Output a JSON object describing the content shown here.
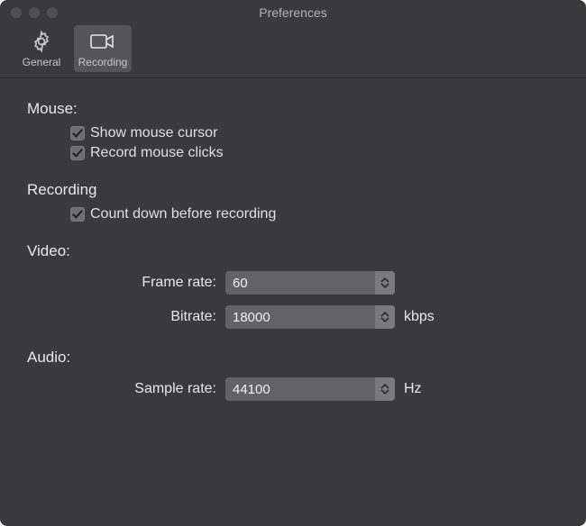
{
  "window": {
    "title": "Preferences"
  },
  "toolbar": {
    "items": [
      {
        "label": "General"
      },
      {
        "label": "Recording"
      }
    ],
    "selectedIndex": 1
  },
  "sections": {
    "mouse": {
      "heading": "Mouse:",
      "options": [
        {
          "label": "Show mouse cursor",
          "checked": true
        },
        {
          "label": "Record mouse clicks",
          "checked": true
        }
      ]
    },
    "recording": {
      "heading": "Recording",
      "options": [
        {
          "label": "Count down before recording",
          "checked": true
        }
      ]
    },
    "video": {
      "heading": "Video:",
      "fields": {
        "frameRate": {
          "label": "Frame rate:",
          "value": "60"
        },
        "bitrate": {
          "label": "Bitrate:",
          "value": "18000",
          "unit": "kbps"
        }
      }
    },
    "audio": {
      "heading": "Audio:",
      "fields": {
        "sampleRate": {
          "label": "Sample rate:",
          "value": "44100",
          "unit": "Hz"
        }
      }
    }
  }
}
